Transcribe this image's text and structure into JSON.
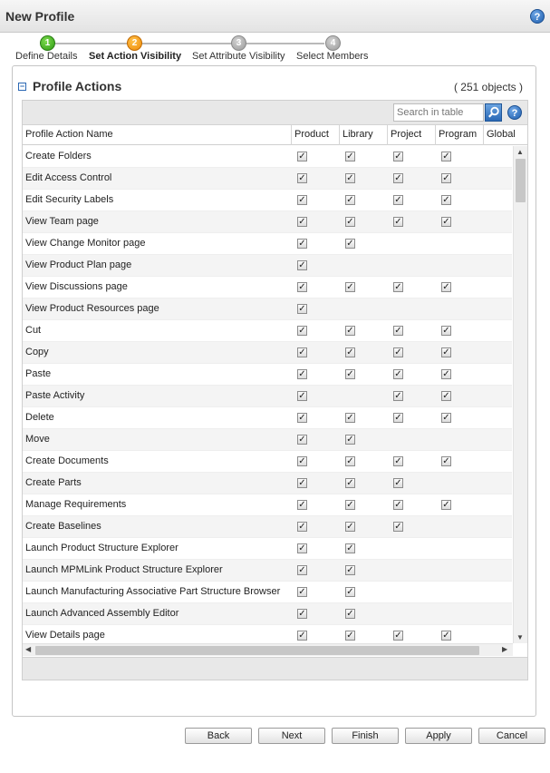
{
  "window": {
    "title": "New Profile",
    "help_icon": "help-icon"
  },
  "wizard": {
    "steps": [
      {
        "number": "1",
        "label": "Define Details",
        "state": "done"
      },
      {
        "number": "2",
        "label": "Set Action Visibility",
        "state": "current"
      },
      {
        "number": "3",
        "label": "Set Attribute Visibility",
        "state": "todo"
      },
      {
        "number": "4",
        "label": "Select Members",
        "state": "todo"
      }
    ]
  },
  "section": {
    "title": "Profile Actions",
    "count": "( 251 objects )",
    "collapse_icon": "collapse-icon"
  },
  "search": {
    "placeholder": "Search in table"
  },
  "table": {
    "columns": [
      "Profile Action Name",
      "Product",
      "Library",
      "Project",
      "Program",
      "Global"
    ],
    "rows": [
      {
        "name": "Create Folders",
        "checks": [
          true,
          true,
          true,
          true
        ]
      },
      {
        "name": "Edit Access Control",
        "checks": [
          true,
          true,
          true,
          true
        ]
      },
      {
        "name": "Edit Security Labels",
        "checks": [
          true,
          true,
          true,
          true
        ]
      },
      {
        "name": "View Team page",
        "checks": [
          true,
          true,
          true,
          true
        ]
      },
      {
        "name": "View Change Monitor page",
        "checks": [
          true,
          true,
          false,
          false
        ]
      },
      {
        "name": "View Product Plan page",
        "checks": [
          true,
          false,
          false,
          false
        ]
      },
      {
        "name": "View Discussions page",
        "checks": [
          true,
          true,
          true,
          true
        ]
      },
      {
        "name": "View Product Resources page",
        "checks": [
          true,
          false,
          false,
          false
        ]
      },
      {
        "name": "Cut",
        "checks": [
          true,
          true,
          true,
          true
        ]
      },
      {
        "name": "Copy",
        "checks": [
          true,
          true,
          true,
          true
        ]
      },
      {
        "name": "Paste",
        "checks": [
          true,
          true,
          true,
          true
        ]
      },
      {
        "name": "Paste Activity",
        "checks": [
          true,
          false,
          true,
          true
        ]
      },
      {
        "name": "Delete",
        "checks": [
          true,
          true,
          true,
          true
        ]
      },
      {
        "name": "Move",
        "checks": [
          true,
          true,
          false,
          false
        ]
      },
      {
        "name": "Create Documents",
        "checks": [
          true,
          true,
          true,
          true
        ]
      },
      {
        "name": "Create Parts",
        "checks": [
          true,
          true,
          true,
          false
        ]
      },
      {
        "name": "Manage Requirements",
        "checks": [
          true,
          true,
          true,
          true
        ]
      },
      {
        "name": "Create Baselines",
        "checks": [
          true,
          true,
          true,
          false
        ]
      },
      {
        "name": "Launch Product Structure Explorer",
        "checks": [
          true,
          true,
          false,
          false
        ]
      },
      {
        "name": "Launch MPMLink Product Structure Explorer",
        "checks": [
          true,
          true,
          false,
          false
        ]
      },
      {
        "name": "Launch Manufacturing Associative Part Structure Browser",
        "checks": [
          true,
          true,
          false,
          false
        ]
      },
      {
        "name": "Launch Advanced Assembly Editor",
        "checks": [
          true,
          true,
          false,
          false
        ]
      },
      {
        "name": "View Details page",
        "checks": [
          true,
          true,
          true,
          true
        ]
      }
    ]
  },
  "buttons": {
    "back": "Back",
    "next": "Next",
    "finish": "Finish",
    "apply": "Apply",
    "cancel": "Cancel"
  },
  "colors": {
    "step_done": "#2c9a12",
    "step_current": "#ef8a07",
    "step_todo": "#9a9a9a",
    "link_blue": "#2a67b3"
  }
}
